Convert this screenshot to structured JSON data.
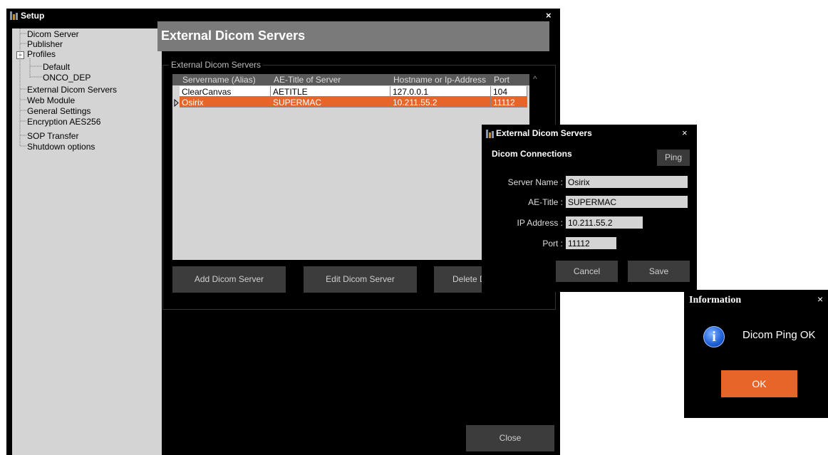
{
  "main_window": {
    "title": "Setup",
    "close_glyph": "×",
    "tree": {
      "dicom_server": "Dicom Server",
      "publisher": "Publisher",
      "profiles": "Profiles",
      "profiles_toggle": "−",
      "default": "Default",
      "onco_dep": "ONCO_DEP",
      "external_dicom_servers": "External Dicom Servers",
      "web_module": "Web Module",
      "general_settings": "General Settings",
      "encryption": "Encryption AES256",
      "sop_transfer": "SOP Transfer",
      "shutdown_options": "Shutdown options"
    },
    "header_title": "External Dicom Servers",
    "group_label": "External Dicom Servers",
    "table": {
      "columns": [
        "Servername (Alias)",
        "AE-Title of Server",
        "Hostname or Ip-Address",
        "Port"
      ],
      "rows": [
        [
          "ClearCanvas",
          "AETITLE",
          "127.0.0.1",
          "104"
        ],
        [
          "Osirix",
          "SUPERMAC",
          "10.211.55.2",
          "11112"
        ]
      ],
      "scroll_up_glyph": "^"
    },
    "buttons": {
      "add": "Add Dicom Server",
      "edit": "Edit Dicom Server",
      "delete": "Delete D",
      "close": "Close"
    }
  },
  "edit_dialog": {
    "title": "External Dicom Servers",
    "close_glyph": "×",
    "section": "Dicom Connections",
    "ping": "Ping",
    "server_name_label": "Server Name :",
    "server_name": "Osirix",
    "ae_title_label": "AE-Title :",
    "ae_title": "SUPERMAC",
    "ip_label": "IP Address :",
    "ip": "10.211.55.2",
    "port_label": "Port :",
    "port": "11112",
    "cancel": "Cancel",
    "save": "Save"
  },
  "info_dialog": {
    "title": "Information",
    "close_glyph": "×",
    "icon_glyph": "i",
    "message": "Dicom Ping OK",
    "ok": "OK"
  },
  "colors": {
    "accent": "#e8652a",
    "panel_gray": "#d4d4d4",
    "button_dark": "#3c3c3c"
  }
}
